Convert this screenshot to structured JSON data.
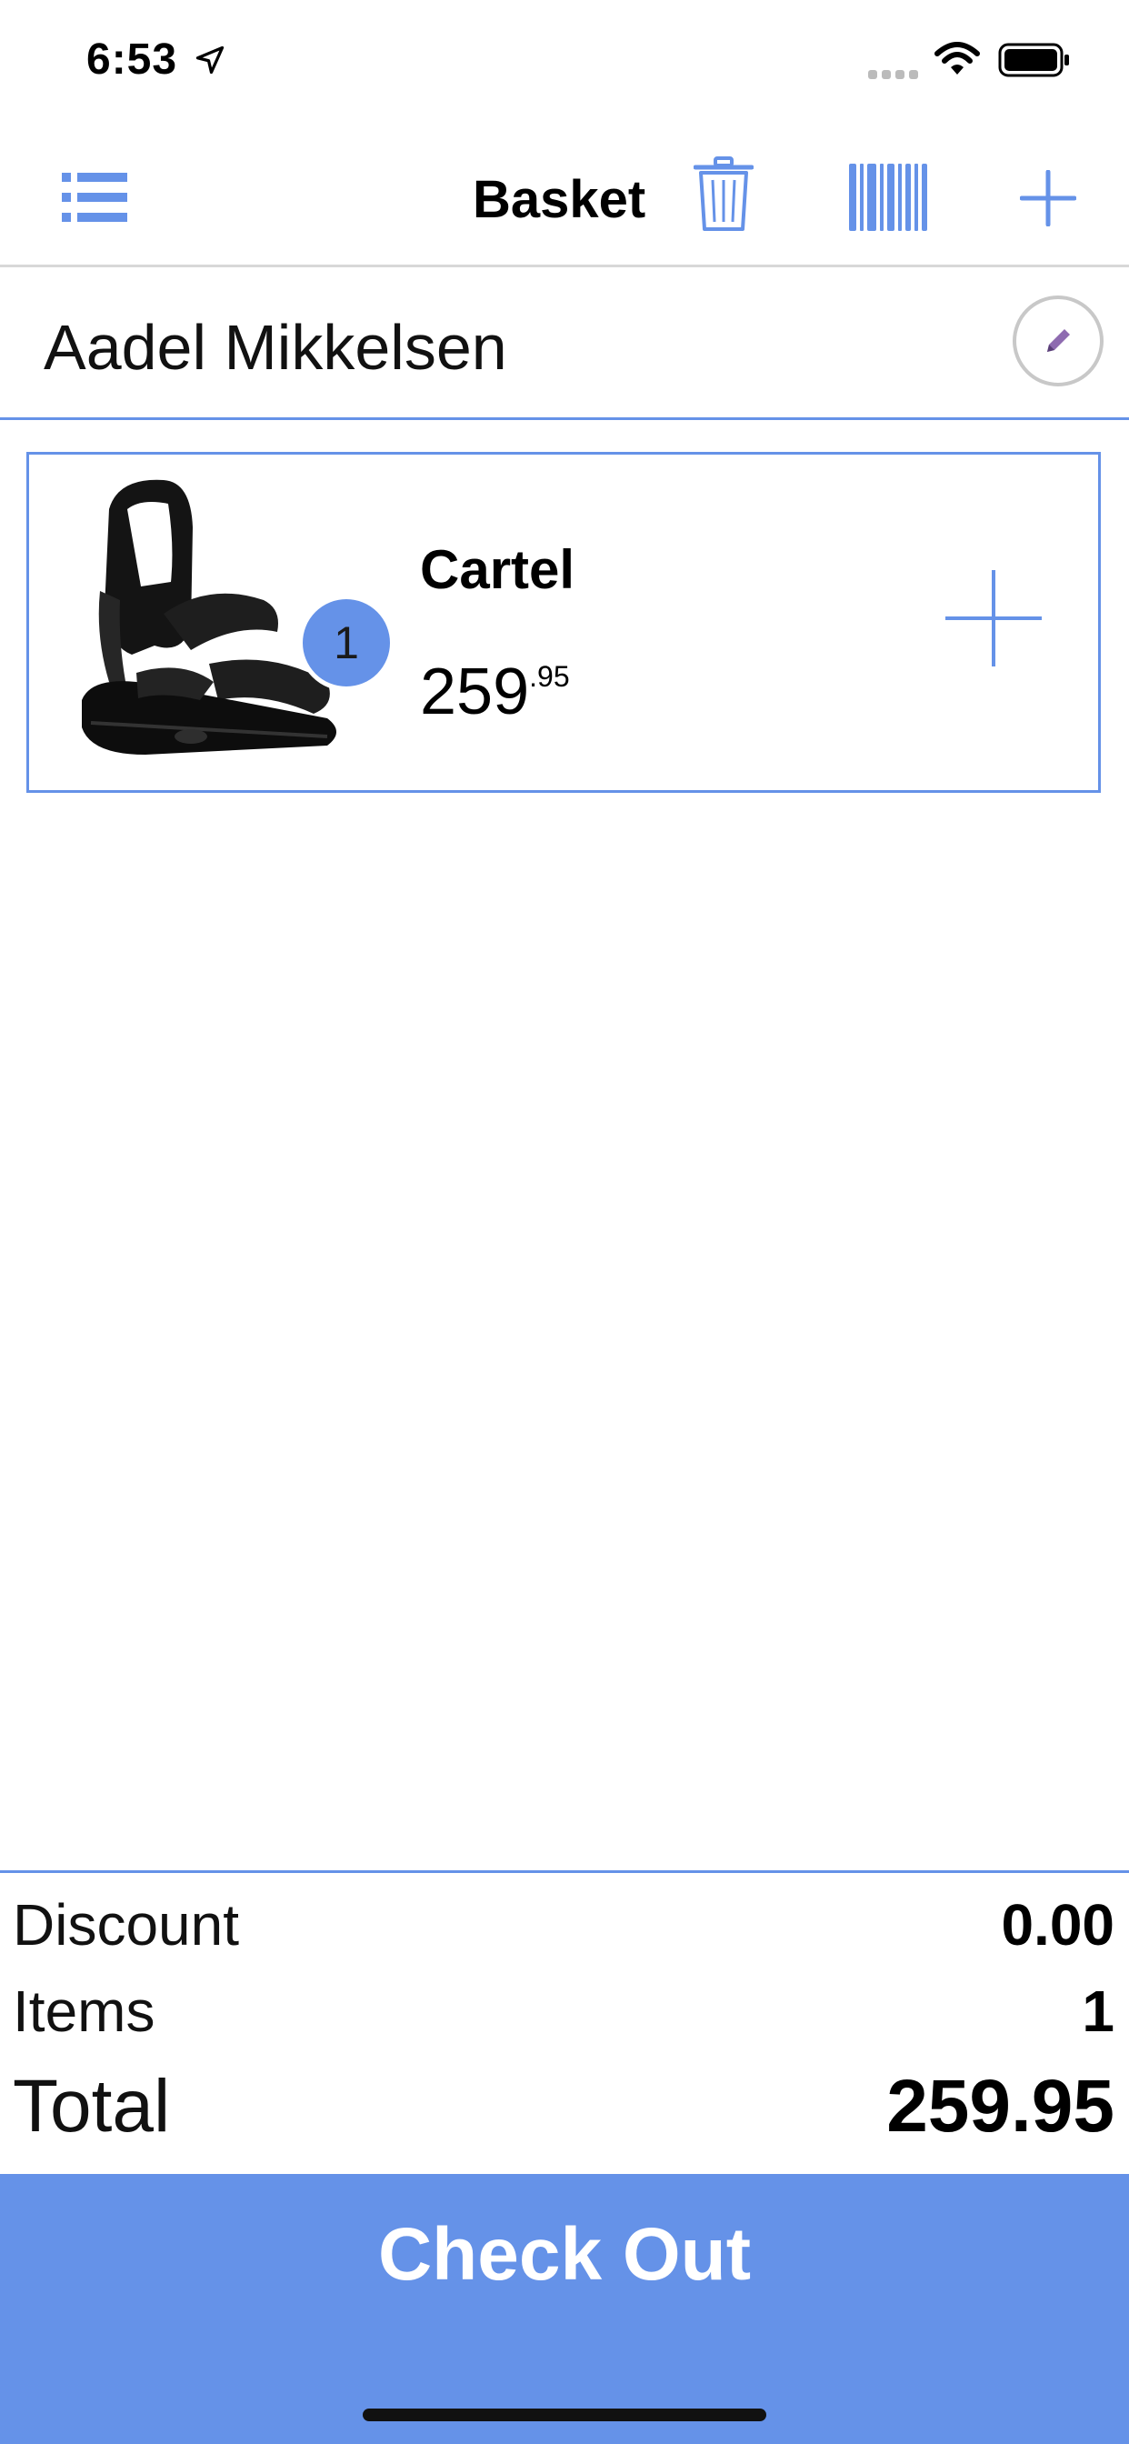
{
  "status_bar": {
    "time": "6:53",
    "icons": [
      "location-arrow-icon",
      "signal-dots-icon",
      "wifi-icon",
      "battery-icon"
    ]
  },
  "nav": {
    "title": "Basket",
    "icons": [
      "list-menu-icon",
      "trash-icon",
      "barcode-icon",
      "plus-icon"
    ]
  },
  "customer": {
    "name": "Aadel Mikkelsen",
    "edit_icon": "pencil-icon"
  },
  "basket": {
    "items": [
      {
        "name": "Cartel",
        "price_whole": "259",
        "price_cents": ".95",
        "quantity": "1",
        "image": "snowboard-binding-image",
        "add_icon": "plus-icon"
      }
    ]
  },
  "summary": {
    "discount_label": "Discount",
    "discount_value": "0.00",
    "items_label": "Items",
    "items_value": "1",
    "total_label": "Total",
    "total_value": "259.95"
  },
  "checkout": {
    "label": "Check Out"
  },
  "colors": {
    "accent": "#6592e8",
    "badge": "#6592e8",
    "edit_pencil": "#8e6bb0",
    "divider_gray": "#d8d8d8"
  }
}
